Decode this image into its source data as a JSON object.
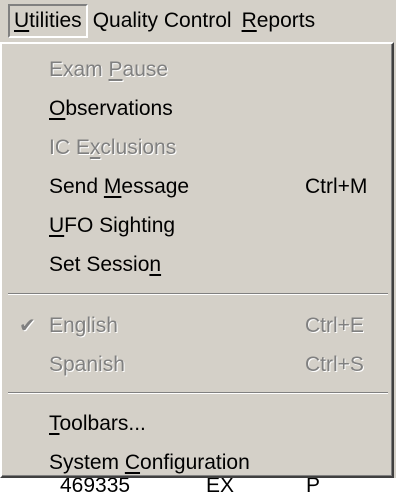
{
  "menubar": {
    "menus": [
      {
        "label_pre": "",
        "label_ul": "U",
        "label_post": "tilities"
      },
      {
        "label": "Quality Control"
      },
      {
        "label_pre": "",
        "label_ul": "R",
        "label_post": "eports"
      }
    ]
  },
  "dropdown": {
    "items": [
      {
        "pre": "Exam ",
        "ul": "P",
        "post": "ause",
        "shortcut": "",
        "enabled": false,
        "checked": false
      },
      {
        "pre": "",
        "ul": "O",
        "post": "bservations",
        "shortcut": "",
        "enabled": true,
        "checked": false
      },
      {
        "pre": "IC E",
        "ul": "x",
        "post": "clusions",
        "shortcut": "",
        "enabled": false,
        "checked": false
      },
      {
        "pre": "Send ",
        "ul": "M",
        "post": "essage",
        "shortcut": "Ctrl+M",
        "enabled": true,
        "checked": false
      },
      {
        "pre": "",
        "ul": "U",
        "post": "FO Sighting",
        "shortcut": "",
        "enabled": true,
        "checked": false
      },
      {
        "pre": "Set Sessio",
        "ul": "n",
        "post": "",
        "shortcut": "",
        "enabled": true,
        "checked": false
      },
      {
        "pre": "English",
        "ul": "",
        "post": "",
        "shortcut": "Ctrl+E",
        "enabled": false,
        "checked": true
      },
      {
        "pre": "Spanish",
        "ul": "",
        "post": "",
        "shortcut": "Ctrl+S",
        "enabled": false,
        "checked": false
      },
      {
        "pre": "",
        "ul": "T",
        "post": "oolbars...",
        "shortcut": "",
        "enabled": true,
        "checked": false
      },
      {
        "pre": "System ",
        "ul": "C",
        "post": "onfiguration",
        "shortcut": "",
        "enabled": true,
        "checked": false
      }
    ],
    "check_glyph": "✔"
  },
  "background": {
    "row": [
      "469335",
      "EX",
      "P"
    ]
  }
}
